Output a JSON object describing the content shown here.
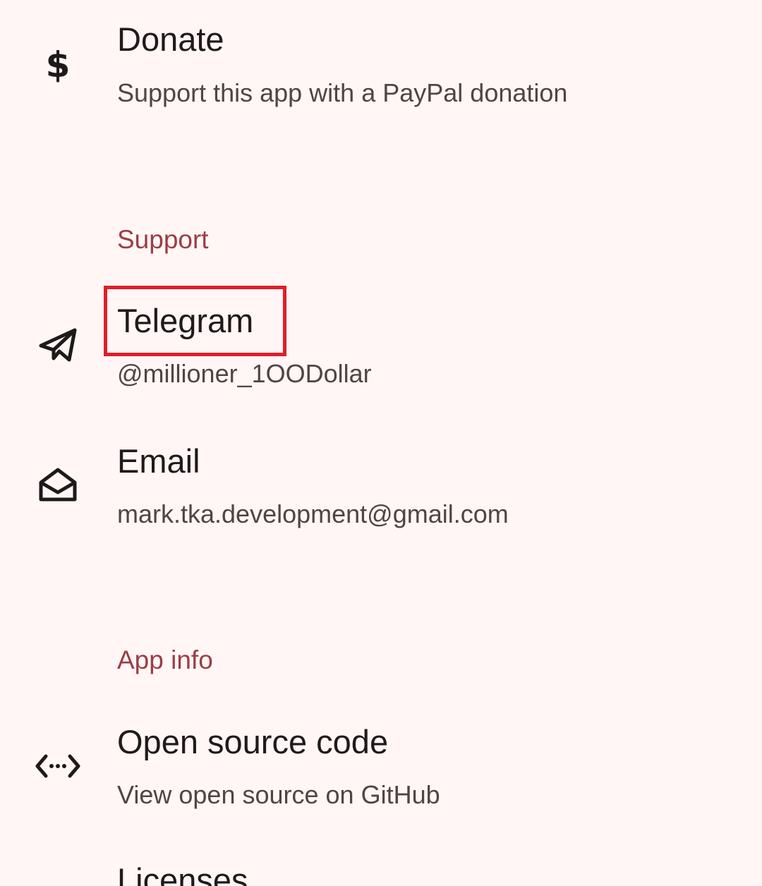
{
  "accent_color": "#9c3d46",
  "highlight_color": "#e01e2a",
  "items": {
    "donate": {
      "icon": "dollar-icon",
      "title": "Donate",
      "summary": "Support this app with a PayPal donation"
    },
    "support_header": "Support",
    "telegram": {
      "icon": "telegram-send-icon",
      "title": "Telegram",
      "summary": "@millioner_1OODollar"
    },
    "email": {
      "icon": "mail-open-icon",
      "title": "Email",
      "summary": "mark.tka.development@gmail.com"
    },
    "appinfo_header": "App info",
    "source": {
      "icon": "code-icon",
      "title": "Open source code",
      "summary": "View open source on GitHub"
    },
    "licenses": {
      "title": "Licenses"
    }
  }
}
